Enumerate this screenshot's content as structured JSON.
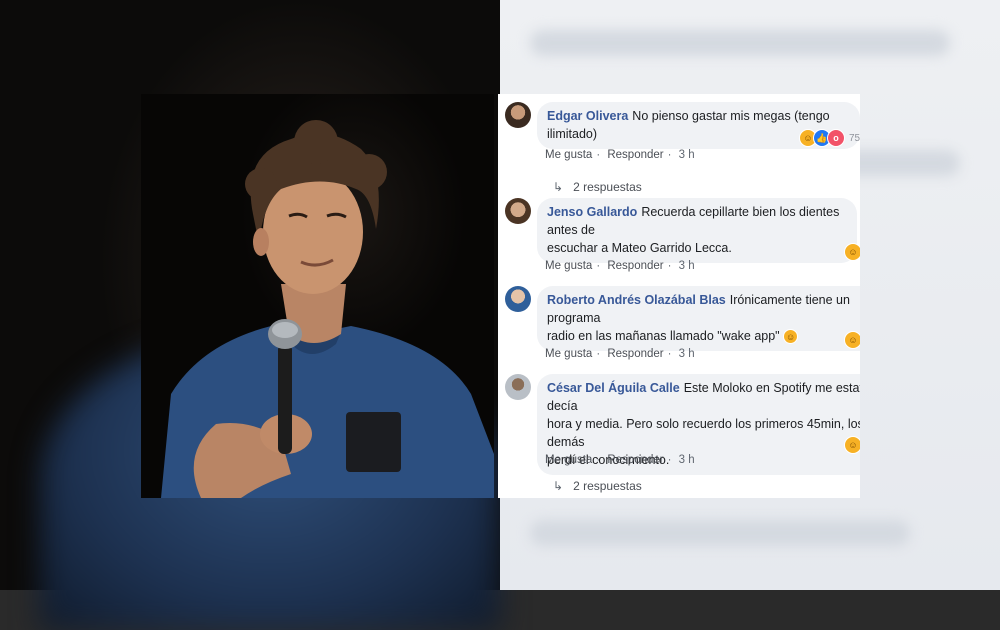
{
  "comments": [
    {
      "author": "Edgar Olivera",
      "text": "No pienso gastar mis megas (tengo ilimitado)",
      "actions": {
        "like": "Me gusta",
        "reply": "Responder",
        "time": "3 h"
      },
      "reaction_count": "75",
      "reactions": [
        "haha-icon",
        "like-icon",
        "wow-icon"
      ],
      "replies": "2 respuestas"
    },
    {
      "author": "Jenso Gallardo",
      "line1": "Recuerda cepillarte bien los dientes antes de",
      "line2": "escuchar a Mateo Garrido Lecca.",
      "actions": {
        "like": "Me gusta",
        "reply": "Responder",
        "time": "3 h"
      },
      "reactions": [
        "haha-icon"
      ]
    },
    {
      "author": "Roberto Andrés Olazábal Blas",
      "line1": "Irónicamente tiene un programa",
      "line2": "radio en las mañanas llamado \"wake app\"",
      "actions": {
        "like": "Me gusta",
        "reply": "Responder",
        "time": "3 h"
      },
      "reactions": [
        "haha-icon"
      ]
    },
    {
      "author": "César Del Águila Calle",
      "line1": "Este Moloko en Spotify me estafó, decía",
      "line2": "hora y media. Pero solo recuerdo los primeros 45min, los demás",
      "line3": "perdí el conocimiento.",
      "actions": {
        "like": "Me gusta",
        "reply": "Responder",
        "time": "3 h"
      },
      "reactions": [
        "haha-icon"
      ],
      "replies": "2 respuestas"
    }
  ],
  "colors": {
    "author": "#385898",
    "bubble": "#f0f2f5",
    "meta": "#606770"
  }
}
